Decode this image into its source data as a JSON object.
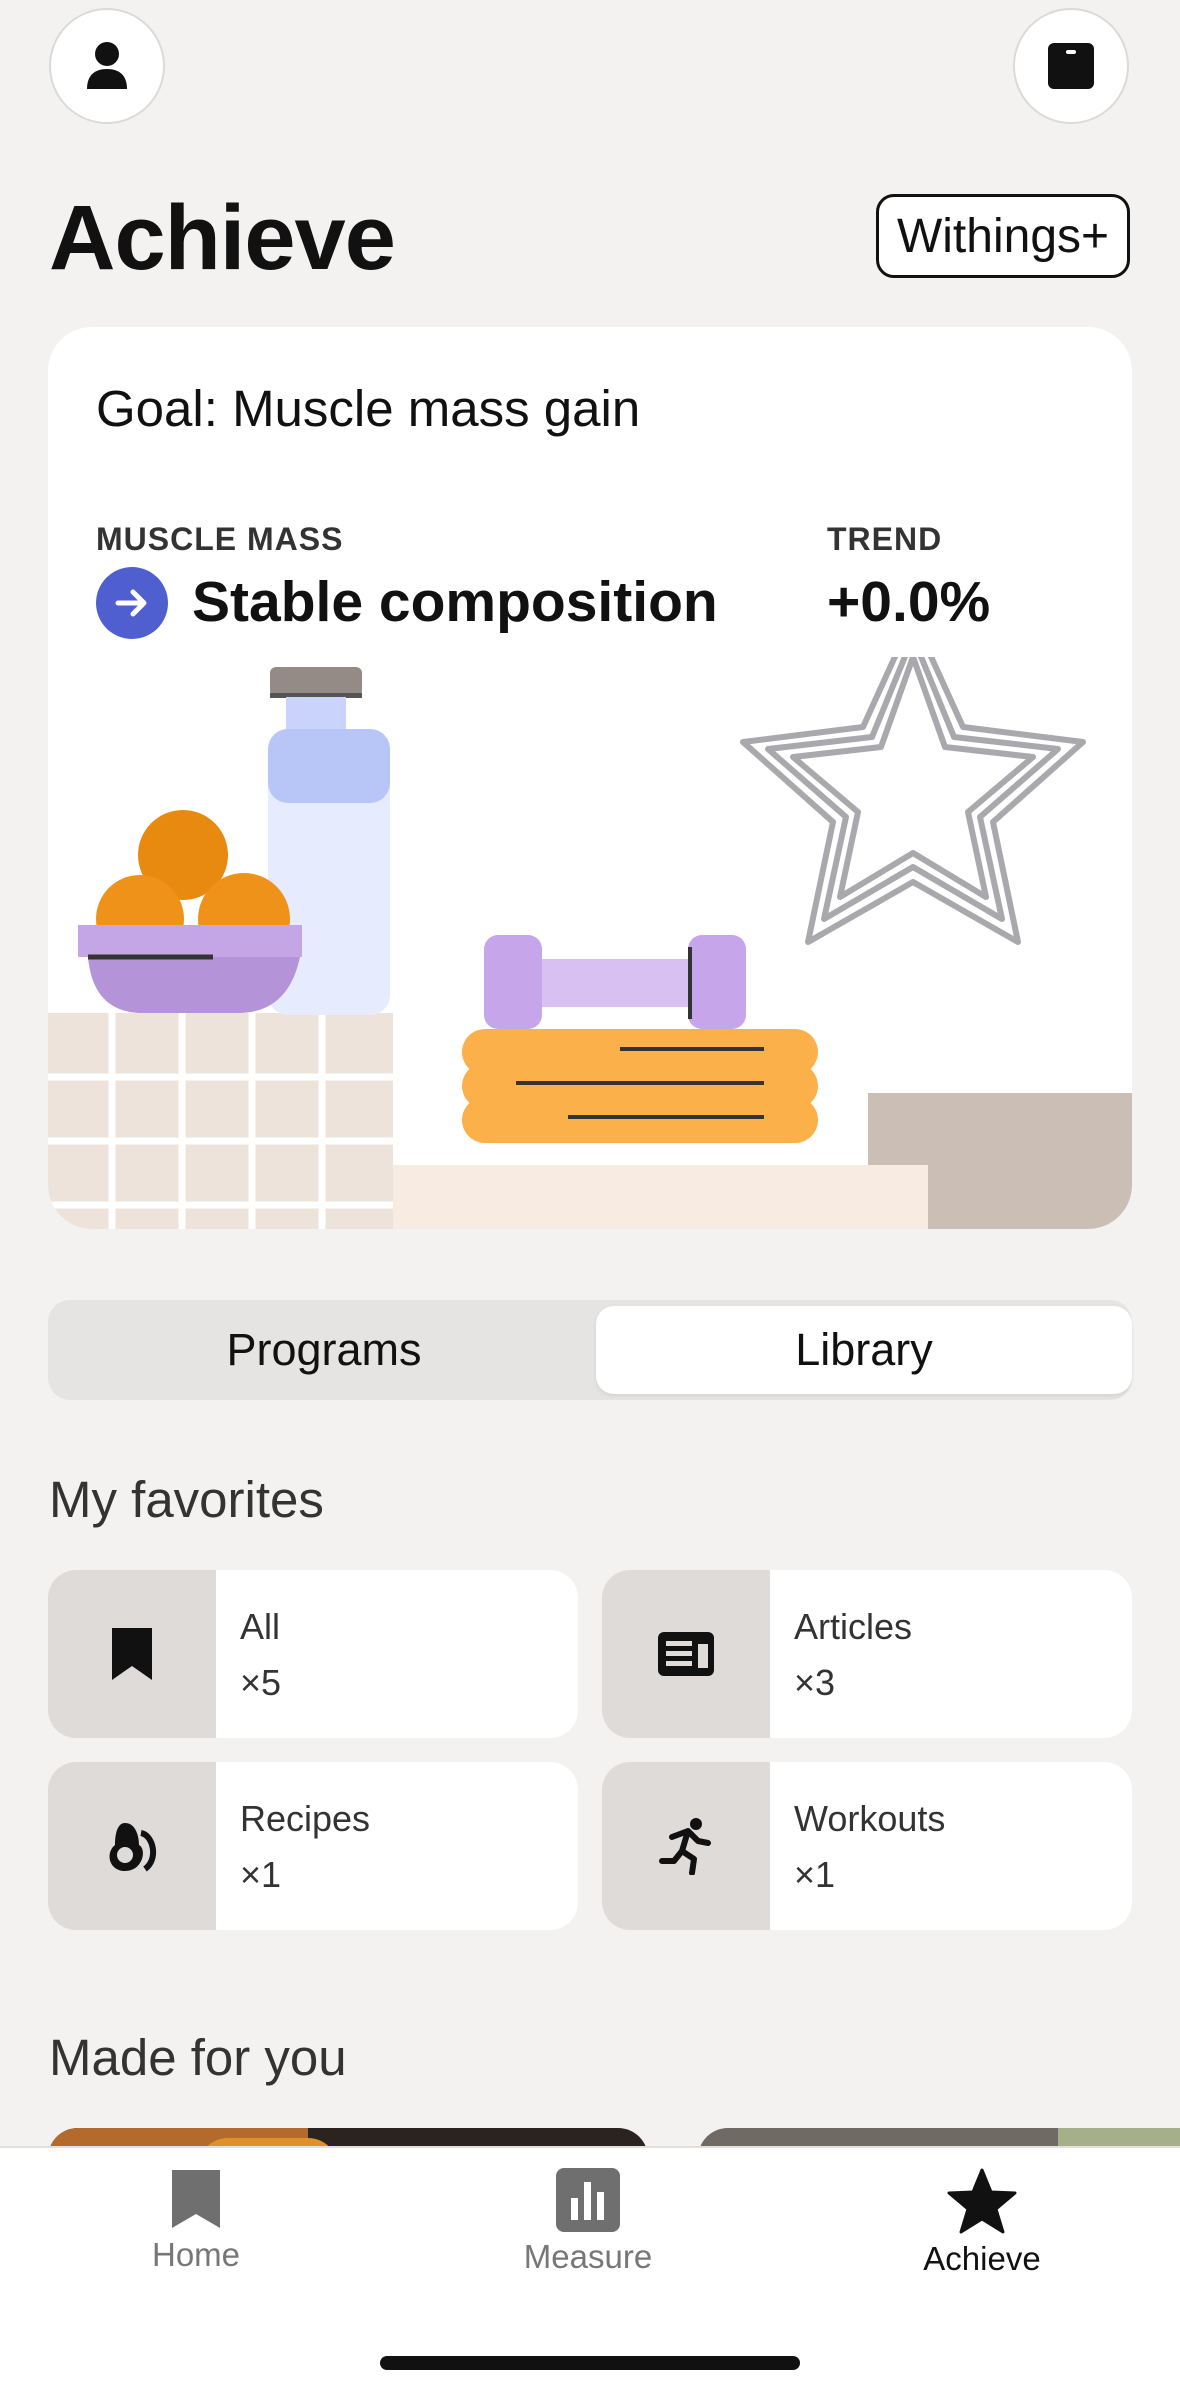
{
  "header": {
    "title": "Achieve",
    "premium_badge": "Withings+",
    "profile_icon": "person-icon",
    "device_icon": "scale-icon"
  },
  "goal_card": {
    "title": "Goal: Muscle mass gain",
    "metric_label": "MUSCLE MASS",
    "metric_value": "Stable composition",
    "trend_label": "TREND",
    "trend_value": "+0.0%",
    "arrow_icon": "arrow-right-icon",
    "accent_color": "#4f5fd0"
  },
  "segmented": {
    "tabs": [
      {
        "label": "Programs",
        "selected": false
      },
      {
        "label": "Library",
        "selected": true
      }
    ]
  },
  "favorites": {
    "title": "My favorites",
    "items": [
      {
        "label": "All",
        "count": "×5",
        "icon": "bookmark-icon"
      },
      {
        "label": "Articles",
        "count": "×3",
        "icon": "article-icon"
      },
      {
        "label": "Recipes",
        "count": "×1",
        "icon": "avocado-icon"
      },
      {
        "label": "Workouts",
        "count": "×1",
        "icon": "running-icon"
      }
    ]
  },
  "made_for_you": {
    "title": "Made for you"
  },
  "tabbar": {
    "items": [
      {
        "label": "Home",
        "icon": "home-icon",
        "active": false
      },
      {
        "label": "Measure",
        "icon": "chart-icon",
        "active": false
      },
      {
        "label": "Achieve",
        "icon": "star-icon",
        "active": true
      }
    ]
  }
}
